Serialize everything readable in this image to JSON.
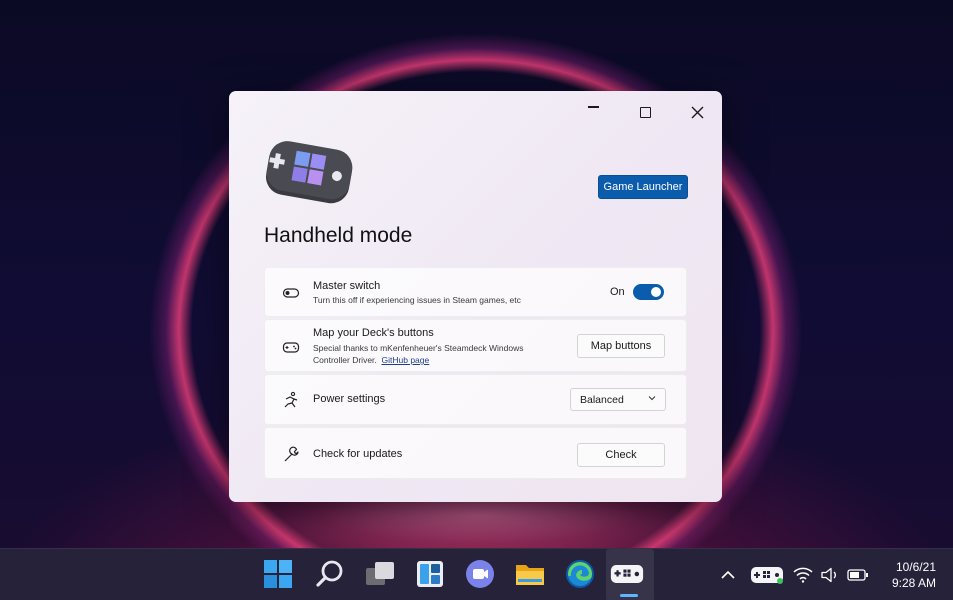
{
  "window": {
    "minimize_label": "",
    "maximize_label": "",
    "close_label": ""
  },
  "header": {
    "launcher_button": "Game Launcher",
    "title": "Handheld mode"
  },
  "settings": {
    "master": {
      "title": "Master switch",
      "description": "Turn this off if experiencing issues in Steam games, etc",
      "toggle_label": "On",
      "toggle_state": true
    },
    "map": {
      "title": "Map your Deck's buttons",
      "description_line1": "Special thanks to mKenfenheuer's Steamdeck Windows",
      "description_line2": "Controller Driver.",
      "link": "GitHub page",
      "button": "Map buttons"
    },
    "power": {
      "title": "Power settings",
      "selected": "Balanced"
    },
    "updates": {
      "title": "Check for updates",
      "button": "Check"
    }
  },
  "taskbar": {
    "apps": [
      "start-icon",
      "search-icon",
      "task-view-icon",
      "widgets-icon",
      "teams-chat-icon",
      "file-explorer-icon",
      "edge-icon",
      "handheld-app-icon"
    ],
    "active_app": "handheld-app-icon"
  },
  "tray": {
    "icons": [
      "chevron-up-icon",
      "controller-icon",
      "wifi-icon",
      "volume-icon",
      "battery-icon"
    ],
    "date": "10/6/21",
    "time": "9:28 AM"
  },
  "colors": {
    "accent": "#0b5cad",
    "taskbar": "#26223a"
  }
}
